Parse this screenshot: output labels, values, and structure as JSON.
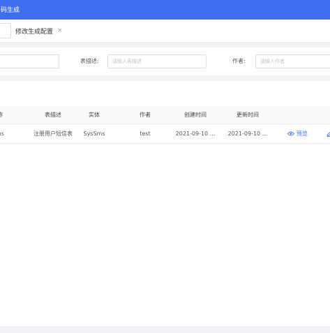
{
  "header": {
    "title": "码生成"
  },
  "tabs": [
    {
      "label": ""
    },
    {
      "label": "修改生成配置",
      "close": "×"
    }
  ],
  "search": {
    "field1": {
      "placeholder": ""
    },
    "table_comment": {
      "label": "表描述:",
      "placeholder": "请输入表描述"
    },
    "author": {
      "label": "作者:",
      "placeholder": "请输入作者"
    }
  },
  "table": {
    "columns": [
      "称",
      "表描述",
      "实体",
      "作者",
      "创建时间",
      "更新时间"
    ],
    "rows": [
      {
        "name": "ms",
        "comment": "注册用户短信表",
        "entity": "SysSms",
        "author": "test",
        "created": "2021-09-10 ...",
        "updated": "2021-09-10 ..."
      }
    ],
    "actions": {
      "preview": "预览"
    }
  },
  "colors": {
    "primary": "#3f6ff0",
    "background": "#f0f2f5"
  },
  "icons": {
    "preview": "eye-icon",
    "edit": "edit-icon",
    "close": "close-icon"
  }
}
